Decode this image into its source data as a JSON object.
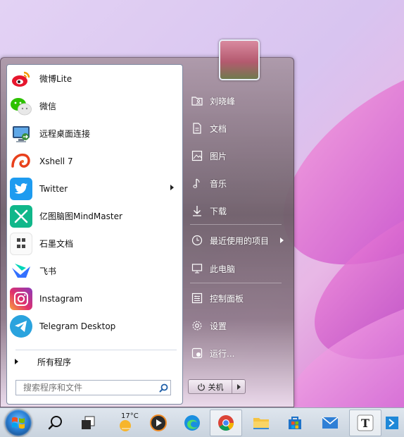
{
  "start_menu": {
    "apps": [
      {
        "label": "微博Lite",
        "icon": "weibo-icon",
        "color": "#ffffff"
      },
      {
        "label": "微信",
        "icon": "wechat-icon",
        "color": "#ffffff"
      },
      {
        "label": "远程桌面连接",
        "icon": "remote-desktop-icon",
        "color": "#ffffff"
      },
      {
        "label": "Xshell 7",
        "icon": "xshell-icon",
        "color": "#ffffff"
      },
      {
        "label": "Twitter",
        "icon": "twitter-icon",
        "color": "#1d9bf0"
      },
      {
        "label": "亿图脑图MindMaster",
        "icon": "mindmaster-icon",
        "color": "#10b78a"
      },
      {
        "label": "石墨文档",
        "icon": "shimo-icon",
        "color": "#ffffff"
      },
      {
        "label": "飞书",
        "icon": "feishu-icon",
        "color": "#ffffff"
      },
      {
        "label": "Instagram",
        "icon": "instagram-icon",
        "color": "#e1306c"
      },
      {
        "label": "Telegram Desktop",
        "icon": "telegram-icon",
        "color": "#2aa3de"
      }
    ],
    "all_programs": "所有程序",
    "search_placeholder": "搜索程序和文件",
    "right_items": [
      {
        "label": "刘晓峰",
        "icon": "user-folder-icon"
      },
      {
        "label": "文档",
        "icon": "document-icon"
      },
      {
        "label": "图片",
        "icon": "picture-icon"
      },
      {
        "label": "音乐",
        "icon": "music-icon"
      },
      {
        "label": "下载",
        "icon": "download-icon"
      },
      {
        "label": "最近使用的项目",
        "icon": "clock-icon"
      },
      {
        "label": "此电脑",
        "icon": "computer-icon"
      },
      {
        "label": "控制面板",
        "icon": "control-panel-icon"
      },
      {
        "label": "设置",
        "icon": "gear-icon"
      },
      {
        "label": "运行...",
        "icon": "run-icon"
      }
    ],
    "shutdown_label": "关机"
  },
  "taskbar": {
    "weather_temp": "17°C",
    "items": [
      "start-orb",
      "search-icon",
      "task-view-icon",
      "weather-icon",
      "media-player-icon",
      "edge-icon",
      "chrome-icon",
      "file-explorer-icon",
      "microsoft-store-icon",
      "mail-icon",
      "typora-icon",
      "remote-icon"
    ]
  }
}
